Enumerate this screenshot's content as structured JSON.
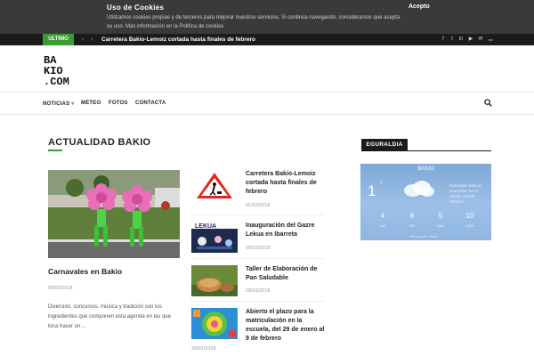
{
  "cookie": {
    "title": "Uso de Cookies",
    "text": "Utilizamos cookies propias y de terceros para mejorar nuestros servicios. Si continúa navegando, consideramos que acepta su uso. Más información en la Política de cookies",
    "accept": "Acepto"
  },
  "topbar": {
    "badge": "ULTIMO",
    "prev": "‹",
    "next": "›",
    "ticker": "Carretera Bakio-Lemoiz cortada hasta finales de febrero",
    "social": [
      "f",
      "t",
      "in",
      "▶",
      "✉",
      "rss"
    ]
  },
  "logo": {
    "line1": "BA",
    "line2": "KIO",
    "line3": ".COM"
  },
  "nav": {
    "items": [
      {
        "label": "NOTICIAS",
        "caret": "▾"
      },
      {
        "label": "METEO"
      },
      {
        "label": "FOTOS"
      },
      {
        "label": "CONTACTA"
      }
    ]
  },
  "section": {
    "title": "ACTUALIDAD BAKIO"
  },
  "featured": {
    "title": "Carnavales en Bakio",
    "date": "06/02/2018",
    "excerpt": "Diversión, concursos, música y tradición son los ingredientes que componen esta agenda en las que toca hacer un…"
  },
  "side_posts": [
    {
      "title": "Carretera Bakio-Lemoiz cortada hasta finales de febrero",
      "date": "01/02/2018"
    },
    {
      "title": "Inauguración del Gazre Lekua en Ibarreta",
      "date": "29/01/2018",
      "thumb_text": "LEKUA"
    },
    {
      "title": "Taller de Elaboración de Pan Saludable",
      "date": "29/01/2018"
    },
    {
      "title": "Abierto el plazo para la matriculación en la escuela, del 29 de enero al 9 de febrero",
      "date": "26/01/2018"
    }
  ],
  "widget": {
    "title": "EGURALDIA",
    "city": "BAKIO",
    "temp": "1",
    "deg": "°",
    "desc": [
      "Humedad relativa",
      "Humedad: 93 %",
      "Viento: 2 km/h",
      "Presión: ..."
    ],
    "forecast": [
      {
        "temp": "4",
        "day": "JUE"
      },
      {
        "temp": "6",
        "day": "VIE"
      },
      {
        "temp": "5",
        "day": "SÁB"
      },
      {
        "temp": "10",
        "day": "DOM"
      }
    ],
    "credit": "Eltiempo.net · Bakio"
  },
  "colors": {
    "accent": "#3d9b35",
    "dark": "#1b1b1b",
    "cookie_bg": "#3a3a3a"
  }
}
